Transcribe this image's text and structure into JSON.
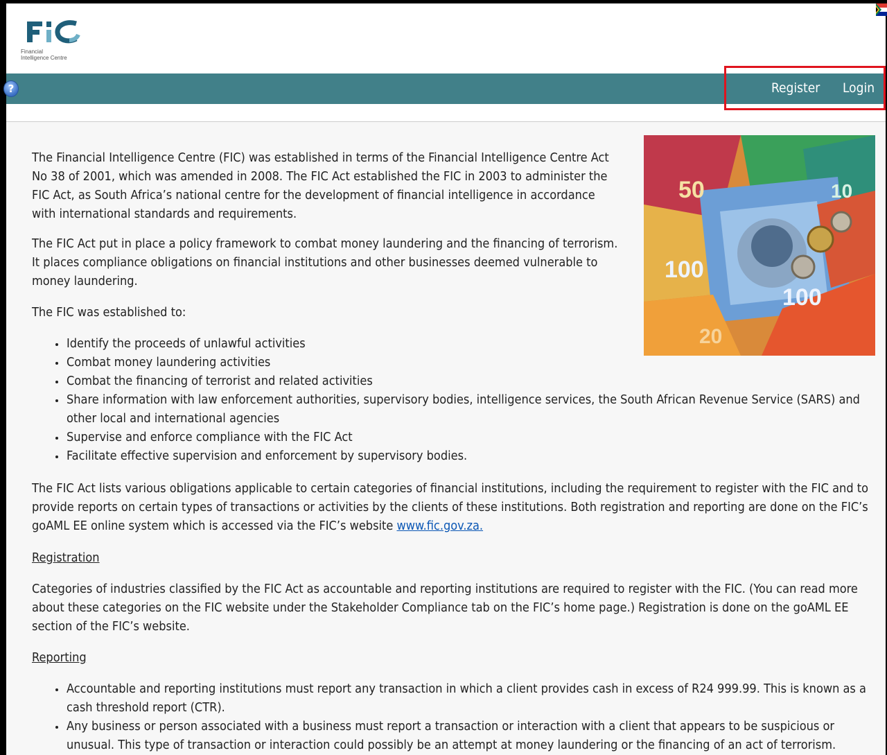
{
  "brand": {
    "logo_text": "FIC",
    "tagline": "Financial Intelligence Centre"
  },
  "nav": {
    "register_label": "Register",
    "login_label": "Login",
    "help_label": "?"
  },
  "colors": {
    "navbar": "#418089",
    "highlight_box": "#e0141e",
    "link": "#0b57b5",
    "content_bg": "#f7f7f7"
  },
  "content": {
    "intro_paragraphs": [
      "The Financial Intelligence Centre (FIC) was established in terms of the Financial Intelligence Centre Act No 38 of 2001, which was amended in 2008. The FIC Act established the FIC in 2003 to administer the FIC Act, as South Africa’s national centre for the development of financial intelligence in accordance with international standards and requirements.",
      "The FIC Act put in place a policy framework to combat money laundering and the financing of terrorism. It places compliance obligations on financial institutions and other businesses deemed vulnerable to money laundering.",
      "The FIC was established to:"
    ],
    "purposes": [
      "Identify the proceeds of unlawful activities",
      "Combat money laundering activities",
      "Combat the financing of terrorist and related activities",
      "Share information with law enforcement authorities, supervisory bodies, intelligence services, the South African Revenue Service (SARS) and other local and international agencies",
      "Supervise and enforce compliance with the FIC Act",
      "Facilitate effective supervision and enforcement by supervisory bodies."
    ],
    "obligations_text": "The FIC Act lists various obligations applicable to certain categories of financial institutions, including the requirement to register with the FIC and to provide reports on certain types of transactions or activities by the clients of these institutions. Both registration and reporting are done on the FIC’s goAML EE online system which is accessed via the FIC’s website",
    "website_link": "www.fic.gov.za.",
    "registration_heading": "Registration",
    "registration_text": "Categories of industries classified by the FIC Act as accountable and reporting institutions are required to register with the FIC. (You can read more about these categories on the FIC website under the Stakeholder Compliance tab on the FIC’s home page.) Registration is done on the goAML EE section of the FIC’s website.",
    "reporting_heading": "Reporting",
    "reporting_items": [
      "Accountable and reporting institutions must report any transaction in which a client provides cash in excess of R24 999.99. This is known as a cash threshold report (CTR).",
      "Any business or person associated with a business must report a transaction or interaction with a client that appears to be suspicious or unusual. This type of transaction or interaction could possibly be an attempt at money laundering or the financing of an act of terrorism."
    ]
  }
}
